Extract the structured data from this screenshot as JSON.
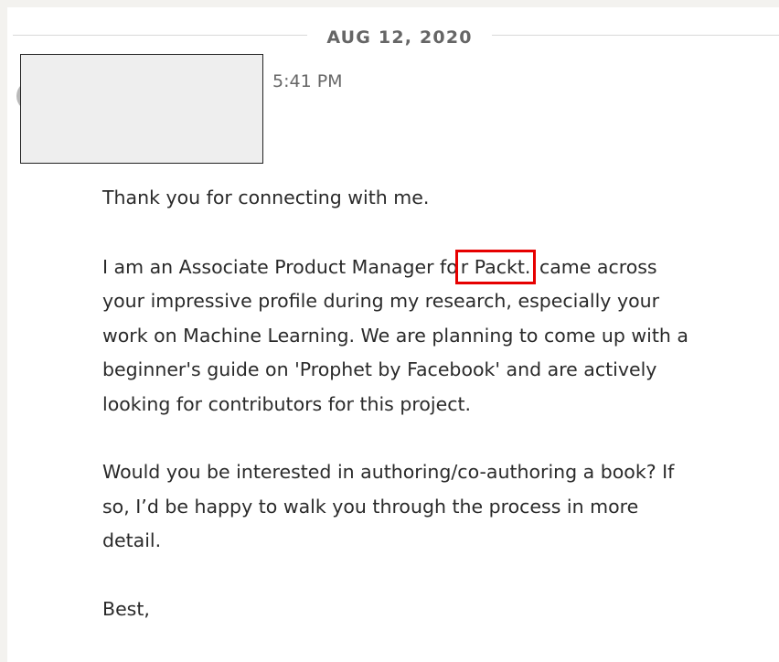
{
  "conversation": {
    "date_divider": "AUG 12, 2020",
    "sender_time": "5:41 PM",
    "message": {
      "p1": "Thank you for connecting with me.",
      "p2_pre": "I am an Associate Product Manager fo",
      "p2_highlight": "r Packt. ",
      "p2_post": " came across your impressive profile during my research, especially your work on Machine Learning. We are planning to come up with a beginner's guide on 'Prophet by Facebook' and are actively looking for contributors for this project.",
      "p3": "Would you be interested in authoring/co-authoring a book? If so, I’d be happy to walk you through the process in more detail.",
      "p4": "Best,"
    }
  },
  "colors": {
    "highlight_border": "#e60000",
    "page_background": "#f3f2ef"
  }
}
